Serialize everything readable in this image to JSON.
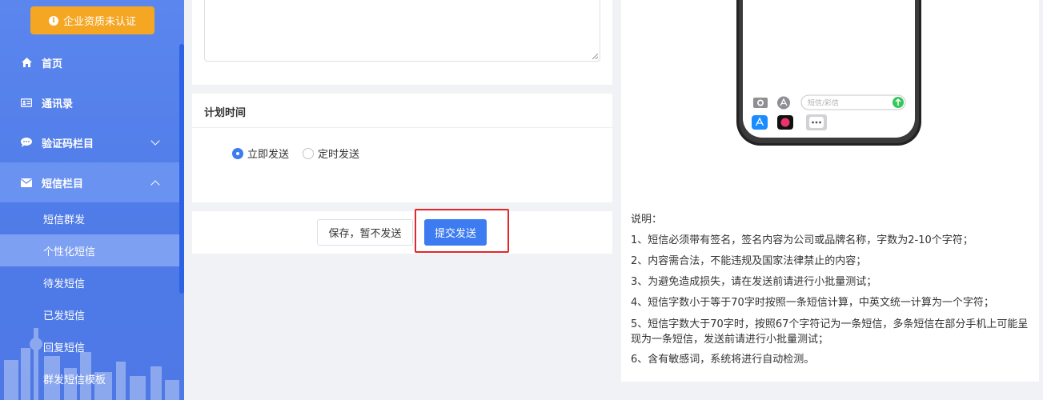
{
  "sidebar": {
    "cert_label": "企业资质未认证",
    "nav": [
      {
        "label": "首页",
        "icon": "home-icon"
      },
      {
        "label": "通讯录",
        "icon": "contacts-card-icon"
      },
      {
        "label": "验证码栏目",
        "icon": "chat-bubble-icon"
      },
      {
        "label": "短信栏目",
        "icon": "envelope-icon"
      }
    ],
    "sub_items": [
      "短信群发",
      "个性化短信",
      "待发短信",
      "已发短信",
      "回复短信",
      "群发短信模板"
    ],
    "active_sub_index": 1
  },
  "schedule": {
    "title": "计划时间",
    "options": [
      "立即发送",
      "定时发送"
    ],
    "selected": "立即发送"
  },
  "actions": {
    "save_label": "保存，暂不发送",
    "submit_label": "提交发送"
  },
  "phone_preview": {
    "input_placeholder": "短信/彩信"
  },
  "notes": {
    "heading": "说明：",
    "items": [
      "1、短信必须带有签名，签名内容为公司或品牌名称，字数为2-10个字符；",
      "2、内容需合法，不能违规及国家法律禁止的内容；",
      "3、为避免造成损失，请在发送前请进行小批量测试；",
      "4、短信字数小于等于70字时按照一条短信计算，中英文统一计算为一个字符；",
      "5、短信字数大于70字时，按照67个字符记为一条短信，多条短信在部分手机上可能呈现为一条短信，发送前请进行小批量测试；",
      "6、含有敏感词，系统将进行自动检测。"
    ]
  },
  "colors": {
    "sidebar_bg": "#4f7be8",
    "accent": "#3d7bf0",
    "warning": "#f5a623",
    "highlight": "#e5262c"
  }
}
